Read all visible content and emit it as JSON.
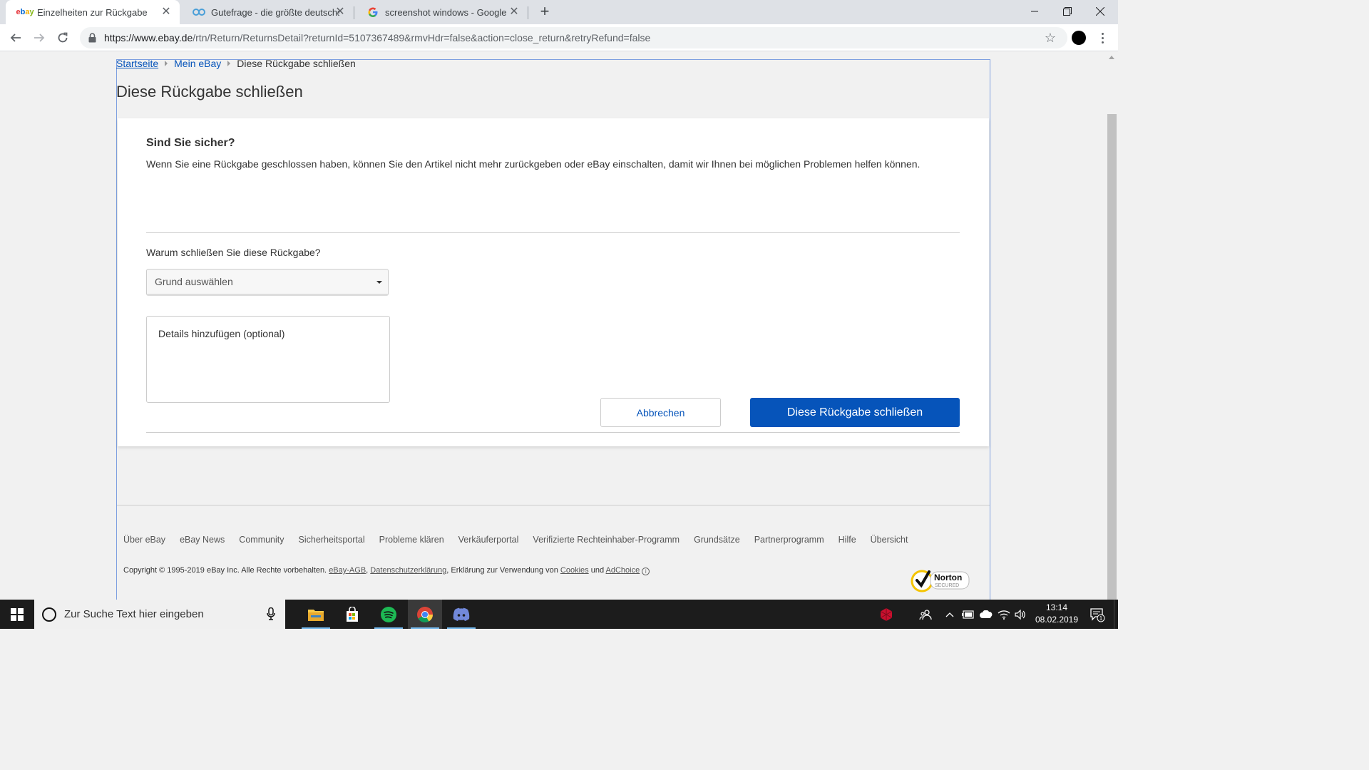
{
  "browser": {
    "tabs": [
      {
        "title": "Einzelheiten zur Rückgabe",
        "favicon": "ebay",
        "active": true
      },
      {
        "title": "Gutefrage - die größte deutschsprachige",
        "favicon": "gutefrage",
        "active": false
      },
      {
        "title": "screenshot windows - Google-Suche",
        "favicon": "google",
        "active": false
      }
    ],
    "url_host": "https://www.ebay.de",
    "url_path": "/rtn/Return/ReturnsDetail?returnId=5107367489&rmvHdr=false&action=close_return&retryRefund=false"
  },
  "breadcrumb": {
    "home": "Startseite",
    "my_ebay": "Mein eBay",
    "current": "Diese Rückgabe schließen"
  },
  "page_title": "Diese Rückgabe schließen",
  "dialog": {
    "heading": "Sind Sie sicher?",
    "description": "Wenn Sie eine Rückgabe geschlossen haben, können Sie den Artikel nicht mehr zurückgeben oder eBay einschalten, damit wir Ihnen bei möglichen Problemen helfen können.",
    "question": "Warum schließen Sie diese Rückgabe?",
    "reason_select": "Grund auswählen",
    "details_placeholder": "Details hinzufügen (optional)",
    "cancel_label": "Abbrechen",
    "confirm_label": "Diese Rückgabe schließen"
  },
  "footer": {
    "links": [
      "Über eBay",
      "eBay News",
      "Community",
      "Sicherheitsportal",
      "Probleme klären",
      "Verkäuferportal",
      "Verifizierte Rechteinhaber-Programm",
      "Grundsätze",
      "Partnerprogramm",
      "Hilfe",
      "Übersicht"
    ],
    "copyright_prefix": "Copyright © 1995-2019 eBay Inc. Alle Rechte vorbehalten.",
    "agb": "eBay-AGB",
    "comma": ",",
    "privacy": "Datenschutzerklärung",
    "usage_text": ", Erklärung zur Verwendung von",
    "cookies": "Cookies",
    "and": "und",
    "adchoice": "AdChoice",
    "norton_name": "Norton",
    "norton_sub": "SECURED"
  },
  "taskbar": {
    "search_placeholder": "Zur Suche Text hier eingeben",
    "time": "13:14",
    "date": "08.02.2019",
    "notification_count": "1"
  },
  "colors": {
    "ebay_blue": "#0654ba",
    "frame_blue": "#7ea0e0"
  }
}
